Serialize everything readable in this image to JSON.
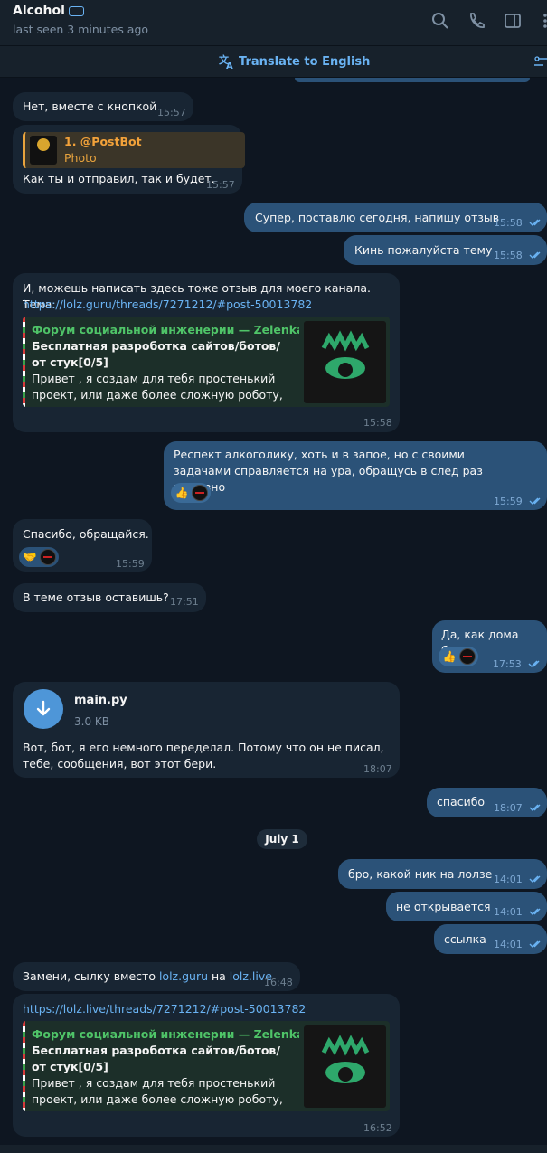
{
  "header": {
    "name": "Alcohol",
    "status": "last seen 3 minutes ago"
  },
  "translate": {
    "label": "Translate to English"
  },
  "messages": {
    "m1": {
      "text": "Нет, вместе с кнопкой",
      "time": "15:57"
    },
    "m2": {
      "reply_title": "1. @PostBot",
      "reply_sub": "Photo",
      "text": "Как ты и отправил, так и будет.",
      "time": "15:57"
    },
    "m3": {
      "text": "Супер, поставлю сегодня, напишу отзыв",
      "time": "15:58"
    },
    "m4": {
      "text": "Кинь пожалуйста тему",
      "time": "15:58"
    },
    "m5": {
      "text": "И, можешь написать здесь тоже отзыв для моего канала. Тема:",
      "link": "https://lolz.guru/threads/7271212/#post-50013782",
      "pv_site": "Форум социальной инженерии — Zelenka....",
      "pv_title": "Бесплатная разроботка сайтов/ботов/от стук[0/5]",
      "pv_desc": "Привет , я создам для тебя простенький проект, или даже более сложную роботу, нап...",
      "time": "15:58"
    },
    "m6": {
      "text": "Респект алкоголику, хоть и в запое, но с своими задачами справляется на ура, обращусь в след раз железно",
      "reaction": "👍",
      "time": "15:59"
    },
    "m7": {
      "text": "Спасибо, обращайся.",
      "reaction": "🤝",
      "time": "15:59"
    },
    "m8": {
      "text": "В теме отзыв оставишь?",
      "time": "17:51"
    },
    "m9": {
      "text": "Да, как дома буду",
      "reaction": "👍",
      "time": "17:53"
    },
    "m10": {
      "file_name": "main.py",
      "file_size": "3.0 KB",
      "text": "Вот, бот, я его немного переделал. Потому что он не писал, тебе, сообщения, вот этот бери.",
      "time": "18:07"
    },
    "m11": {
      "text": "спасибо",
      "time": "18:07"
    },
    "date": "July 1",
    "m12": {
      "text": "бро, какой ник на лолзе",
      "time": "14:01"
    },
    "m13": {
      "text": "не открывается",
      "time": "14:01"
    },
    "m14": {
      "text": "ссылка",
      "time": "14:01"
    },
    "m15": {
      "text_a": "Замени, сылку вместо ",
      "link_a": "lolz.guru",
      "text_b": " на ",
      "link_b": "lolz.live",
      "time": "16:48"
    },
    "m16": {
      "link": "https://lolz.live/threads/7271212/#post-50013782",
      "pv_site": "Форум социальной инженерии — Zelenka....",
      "pv_title": "Бесплатная разроботка сайтов/ботов/от стук[0/5]",
      "pv_desc": "Привет , я создам для тебя простенький проект, или даже более сложную роботу, нап...",
      "time": "16:52"
    }
  },
  "colors": {
    "bg": "#0e1621",
    "incoming": "#182533",
    "outgoing": "#2b5278",
    "link": "#6ab3f3",
    "accent_green": "#4fc468"
  },
  "icons": [
    "search-icon",
    "phone-icon",
    "sidebar-icon",
    "more-icon",
    "translate-icon",
    "download-icon",
    "double-check-icon"
  ]
}
